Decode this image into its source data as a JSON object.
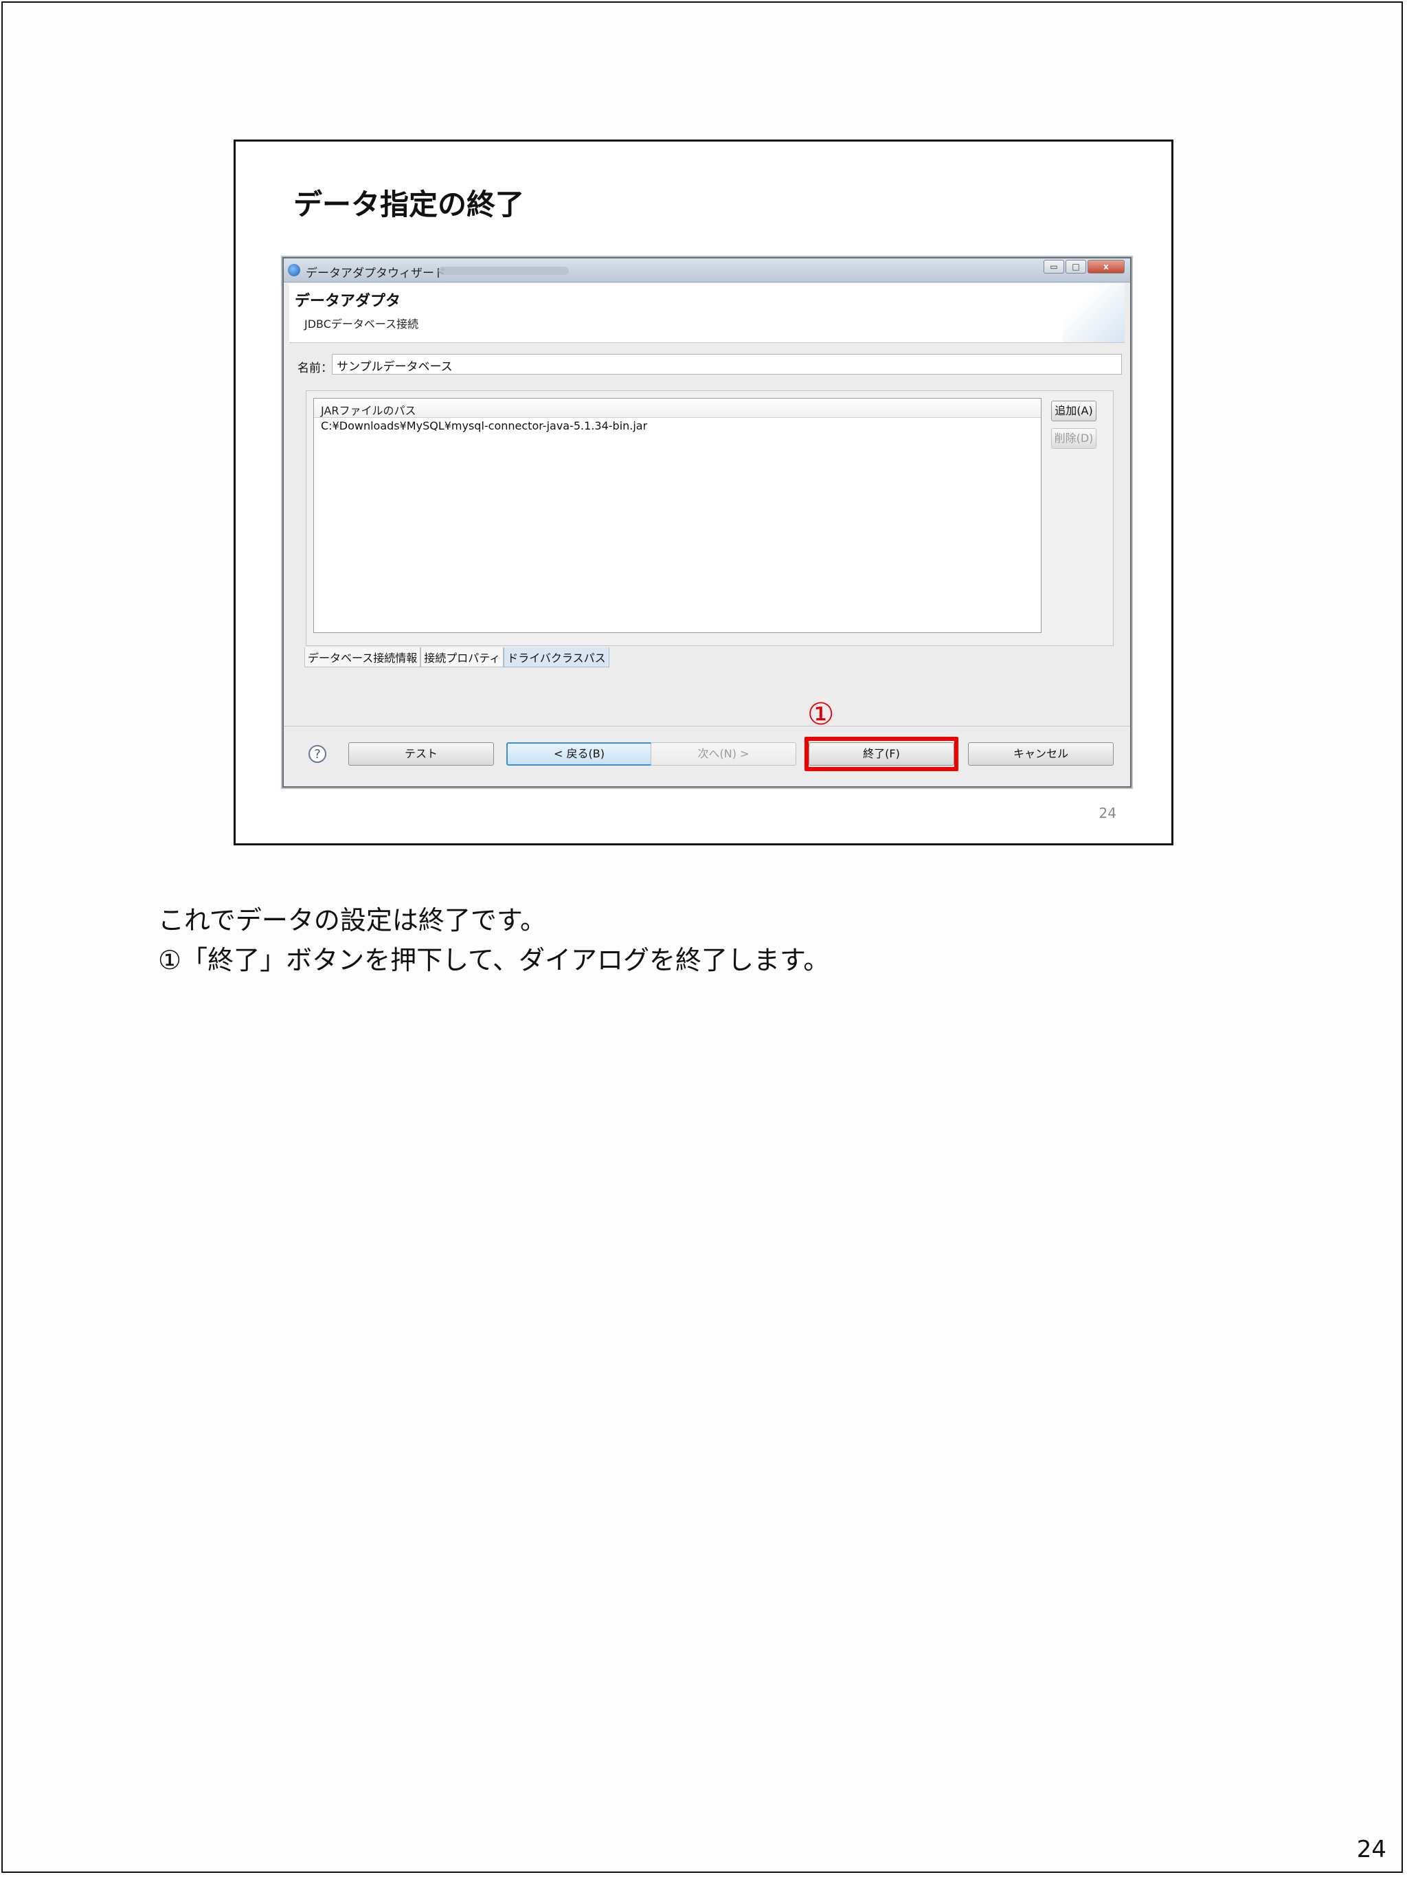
{
  "slide": {
    "title": "データ指定の終了",
    "slide_number": "24"
  },
  "dialog": {
    "window_title": "データアダプタウィザード",
    "window_buttons": {
      "minimize": "▭",
      "maximize": "□",
      "close": "x"
    },
    "header_title": "データアダプタ",
    "header_subtitle": "JDBCデータベース接続",
    "name_label": "名前：",
    "name_value": "サンプルデータベース",
    "jar_list": {
      "header": "JARファイルのパス",
      "rows": [
        "C:¥Downloads¥MySQL¥mysql-connector-java-5.1.34-bin.jar"
      ]
    },
    "side_buttons": {
      "add": "追加(A)",
      "delete": "削除(D)"
    },
    "tabs": [
      "データベース接続情報",
      "接続プロパティ",
      "ドライバクラスパス"
    ],
    "help_icon": "?",
    "buttons": {
      "test": "テスト",
      "back": "< 戻る(B)",
      "next": "次へ(N) >",
      "finish": "終了(F)",
      "cancel": "キャンセル"
    },
    "callout": "①",
    "highlight_color": "#ee0000"
  },
  "notes": {
    "line1": "これでデータの設定は終了です。",
    "line2": "①「終了」ボタンを押下して、ダイアログを終了します。"
  },
  "page_number": "24"
}
